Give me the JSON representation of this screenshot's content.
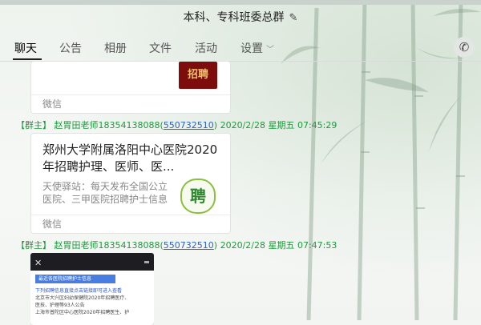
{
  "window": {
    "title": "本科、专科班委总群",
    "edit_icon": "edit-icon"
  },
  "tabs": [
    {
      "label": "聊天",
      "active": true
    },
    {
      "label": "公告"
    },
    {
      "label": "相册"
    },
    {
      "label": "文件"
    },
    {
      "label": "活动"
    },
    {
      "label": "设置",
      "has_dropdown": true
    }
  ],
  "phone_icon": "phone-icon",
  "messages": [
    {
      "source": "微信",
      "thumb_text": "招聘"
    },
    {
      "role": "【群主】",
      "name": "赵胃田老师18354138088",
      "qq_open": "(",
      "qq": "550732510",
      "qq_close": ")",
      "time": "2020/2/28 星期五 07:45:29",
      "card": {
        "title": "郑州大学附属洛阳中心医院2020年招聘护理、医师、医...",
        "desc": "天使驿站：每天发布全国公立医院、三甲医院招聘护士信息",
        "logo_text": "聘",
        "source": "微信"
      }
    },
    {
      "role": "【群主】",
      "name": "赵胃田老师18354138088",
      "qq_open": "(",
      "qq": "550732510",
      "qq_close": ")",
      "time": "2020/2/28 星期五 07:47:53",
      "screenshot": {
        "close": "✕",
        "button": "最近各医院招聘护士信息",
        "lines": [
          "下列招聘信息直接点击链接即可进入查看",
          "北京市大兴区妇幼保健院2020年招聘医疗、",
          "医技、护理等93人公告",
          "上海市普陀区中心医院2020年招聘医生、护"
        ]
      }
    }
  ]
}
